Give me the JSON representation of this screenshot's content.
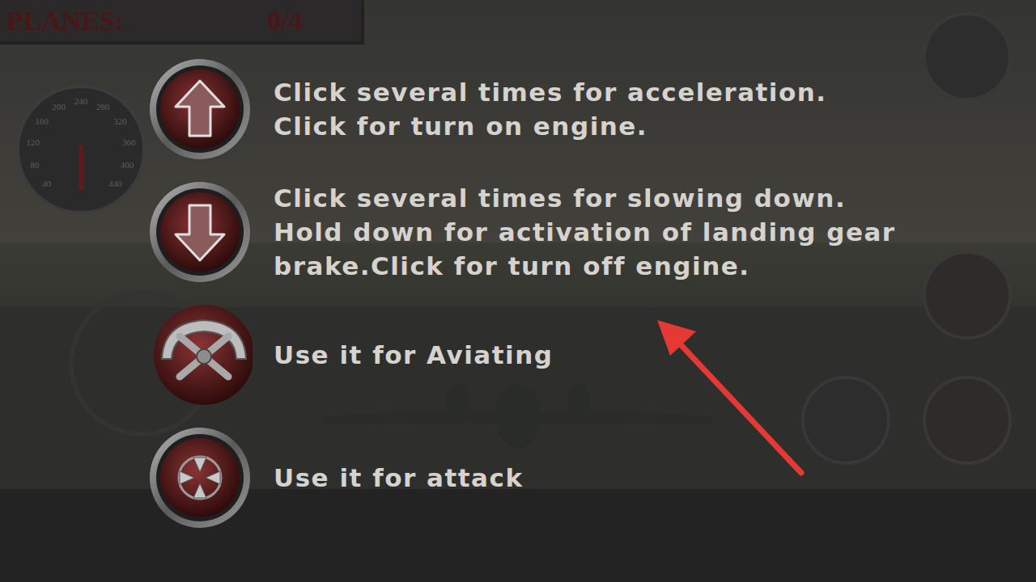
{
  "hud": {
    "planes_label": "PLANES:",
    "planes_count": "0/4",
    "speedometer_ticks": [
      "40",
      "80",
      "120",
      "160",
      "200",
      "240",
      "280",
      "320",
      "360",
      "400",
      "440"
    ]
  },
  "instructions": [
    {
      "kind": "accelerate",
      "lines": [
        "Click several times for acceleration.",
        "Click for turn on engine."
      ]
    },
    {
      "kind": "decelerate",
      "lines": [
        "Click several times for slowing down.",
        "Hold down for activation of landing gear",
        "brake.Click for turn off engine."
      ]
    },
    {
      "kind": "steer",
      "lines": [
        "Use it for Aviating"
      ]
    },
    {
      "kind": "attack",
      "lines": [
        "Use it for attack"
      ]
    }
  ]
}
